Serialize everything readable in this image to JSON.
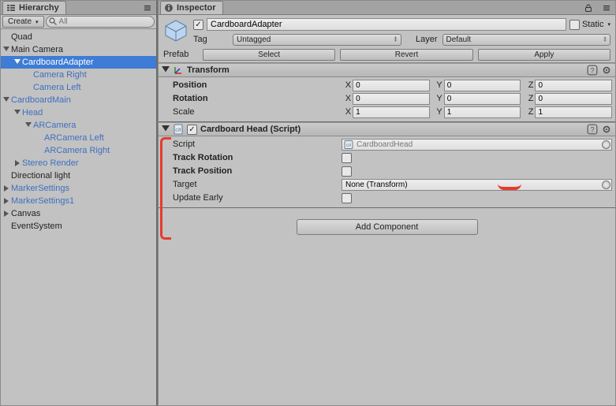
{
  "hierarchy": {
    "tab": "Hierarchy",
    "create_label": "Create",
    "search_placeholder": "All",
    "items": [
      {
        "label": "Quad",
        "depth": 0,
        "expand": "leaf",
        "prefab": false
      },
      {
        "label": "Main Camera",
        "depth": 0,
        "expand": "open",
        "prefab": false
      },
      {
        "label": "CardboardAdapter",
        "depth": 1,
        "expand": "open",
        "prefab": true,
        "selected": true
      },
      {
        "label": "Camera Right",
        "depth": 2,
        "expand": "leaf",
        "prefab": true
      },
      {
        "label": "Camera Left",
        "depth": 2,
        "expand": "leaf",
        "prefab": true
      },
      {
        "label": "CardboardMain",
        "depth": 0,
        "expand": "open",
        "prefab": true
      },
      {
        "label": "Head",
        "depth": 1,
        "expand": "open",
        "prefab": true
      },
      {
        "label": "ARCamera",
        "depth": 2,
        "expand": "open",
        "prefab": true
      },
      {
        "label": "ARCamera Left",
        "depth": 3,
        "expand": "leaf",
        "prefab": true
      },
      {
        "label": "ARCamera Right",
        "depth": 3,
        "expand": "leaf",
        "prefab": true
      },
      {
        "label": "Stereo Render",
        "depth": 1,
        "expand": "closed",
        "prefab": true
      },
      {
        "label": "Directional light",
        "depth": 0,
        "expand": "leaf",
        "prefab": false
      },
      {
        "label": "MarkerSettings",
        "depth": 0,
        "expand": "closed",
        "prefab": true
      },
      {
        "label": "MarkerSettings1",
        "depth": 0,
        "expand": "closed",
        "prefab": true
      },
      {
        "label": "Canvas",
        "depth": 0,
        "expand": "closed",
        "prefab": false
      },
      {
        "label": "EventSystem",
        "depth": 0,
        "expand": "leaf",
        "prefab": false
      }
    ]
  },
  "inspector": {
    "tab": "Inspector",
    "object_name": "CardboardAdapter",
    "active": true,
    "static_label": "Static",
    "tag_label": "Tag",
    "tag_value": "Untagged",
    "layer_label": "Layer",
    "layer_value": "Default",
    "prefab_label": "Prefab",
    "prefab_buttons": [
      "Select",
      "Revert",
      "Apply"
    ],
    "transform": {
      "title": "Transform",
      "position_label": "Position",
      "position": {
        "x": "0",
        "y": "0",
        "z": "0"
      },
      "rotation_label": "Rotation",
      "rotation": {
        "x": "0",
        "y": "0",
        "z": "0"
      },
      "scale_label": "Scale",
      "scale": {
        "x": "1",
        "y": "1",
        "z": "1"
      }
    },
    "head": {
      "title": "Cardboard Head (Script)",
      "script_label": "Script",
      "script_value": "CardboardHead",
      "track_rotation_label": "Track Rotation",
      "track_rotation": false,
      "track_position_label": "Track Position",
      "track_position": false,
      "target_label": "Target",
      "target_value": "None (Transform)",
      "update_early_label": "Update Early",
      "update_early": false
    },
    "add_component": "Add Component"
  }
}
